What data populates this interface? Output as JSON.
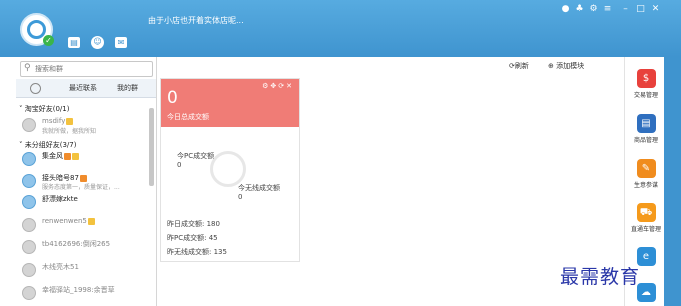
{
  "header": {
    "signature": "由于小店也开着实体店呢...",
    "icons": [
      "profile-card-icon",
      "shop-icon",
      "mail-icon"
    ],
    "window_controls": [
      "skin-icon",
      "shirt-icon",
      "settings-icon",
      "menu-icon",
      "minimize-icon",
      "maximize-icon",
      "close-icon"
    ]
  },
  "left": {
    "search_placeholder": "搜索和群",
    "tabs": [
      "",
      "最近联系",
      "我的群"
    ],
    "groups": [
      {
        "label": "淘宝好友(0/1)"
      },
      {
        "label": "未分组好友(3/7)"
      }
    ],
    "contacts": [
      {
        "name": "msdify",
        "sig": "我就所做，据我所知",
        "online": false,
        "badges": [
          "y"
        ]
      },
      {
        "name": "集金风",
        "sig": "",
        "online": true,
        "badges": [
          "o",
          "y"
        ]
      },
      {
        "name": "接头暗号87",
        "sig": "服务态度第一，质量保证，...",
        "online": true,
        "badges": [
          "o"
        ]
      },
      {
        "name": "舒漂嫁zkte",
        "sig": "",
        "online": true,
        "badges": []
      },
      {
        "name": "renwenwen5",
        "sig": "",
        "online": false,
        "badges": [
          "y"
        ]
      },
      {
        "name": "tb4162696:倒闲265",
        "sig": "",
        "online": false,
        "badges": []
      },
      {
        "name": "木线亮木51",
        "sig": "",
        "online": false,
        "badges": []
      },
      {
        "name": "幸福驿站_1998:余晋草",
        "sig": "",
        "online": false,
        "badges": []
      }
    ]
  },
  "main": {
    "refresh_label": "刷新",
    "add_module_label": "添加模块",
    "card": {
      "value": "0",
      "label": "今日总成交额",
      "pc_label": "今PC成交额",
      "pc_value": "0",
      "wireless_label": "今无线成交额",
      "wireless_value": "0",
      "yesterday_total": "昨日成交额: 180",
      "yesterday_pc": "昨PC成交额: 45",
      "yesterday_wireless": "昨无线成交额: 135"
    }
  },
  "toolbar": {
    "items": [
      {
        "label": "交易管理",
        "icon": "trade-icon",
        "color": "#e8413c",
        "glyph": "$"
      },
      {
        "label": "商品管理",
        "icon": "goods-icon",
        "color": "#2f6fbf",
        "glyph": "▤"
      },
      {
        "label": "生意参谋",
        "icon": "business-advisor-icon",
        "color": "#f08c1e",
        "glyph": "✎"
      },
      {
        "label": "直通车管理",
        "icon": "car-icon",
        "color": "#f59a1b",
        "glyph": "⛟"
      },
      {
        "label": "",
        "icon": "circle-e-icon",
        "color": "#2d8fd6",
        "glyph": "e"
      },
      {
        "label": "",
        "icon": "cloud-icon",
        "color": "#2d8fd6",
        "glyph": "☁"
      }
    ]
  },
  "watermark": "最需教育"
}
